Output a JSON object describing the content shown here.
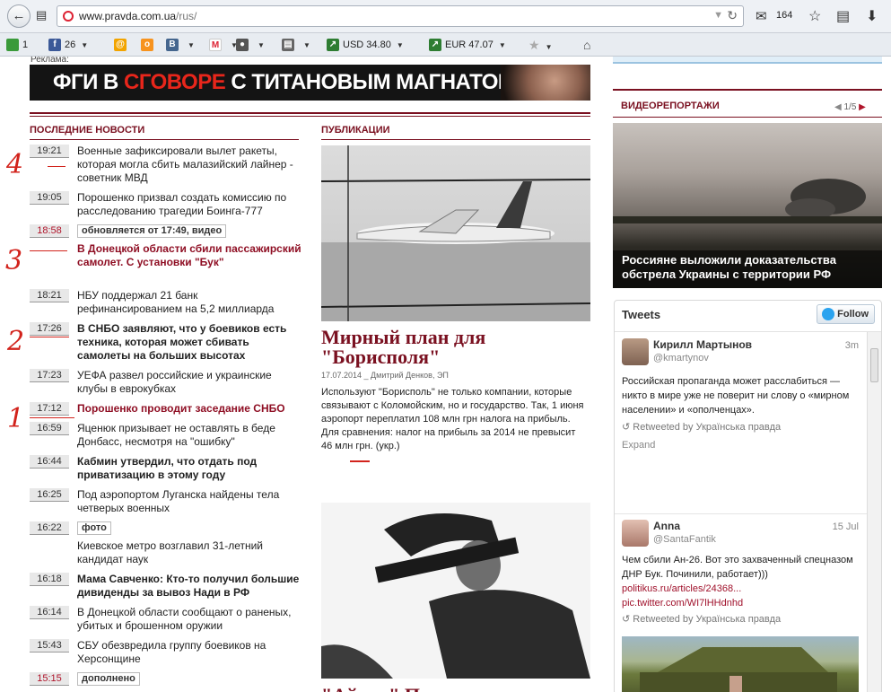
{
  "browser": {
    "url_domain": "www.pravda.com.ua",
    "url_path": "/rus/",
    "mail_count": "164"
  },
  "bookmarks": [
    {
      "label": "1",
      "icon": "home-green-icon"
    },
    {
      "label": "26",
      "icon": "facebook-icon"
    },
    {
      "label": "",
      "icon": "mail-ru-icon"
    },
    {
      "label": "",
      "icon": "odnoklassniki-icon"
    },
    {
      "label": "",
      "icon": "vkontakte-icon"
    },
    {
      "label": "",
      "icon": "gmail-icon"
    },
    {
      "label": "",
      "icon": "camera-icon"
    },
    {
      "label": "",
      "icon": "film-icon"
    },
    {
      "label": "USD 34.80",
      "icon": "chart-icon"
    },
    {
      "label": "EUR 47.07",
      "icon": "chart-icon"
    },
    {
      "label": "",
      "icon": "star-icon"
    },
    {
      "label": "",
      "icon": "home-icon"
    }
  ],
  "ad": {
    "label": "Реклама:",
    "text_white_1": "ФГИ В ",
    "text_red": "СГОВОРЕ",
    "text_white_2": " С ТИТАНОВЫМ МАГНАТОМ"
  },
  "news": {
    "heading": "ПОСЛЕДНИЕ НОВОСТИ",
    "items": [
      {
        "time": "19:21",
        "text": "Военные зафиксировали вылет ракеты, которая могла сбить малазийский лайнер - советник МВД",
        "style": ""
      },
      {
        "time": "19:05",
        "text": "Порошенко призвал создать комиссию по расследованию трагедии Боинга-777",
        "style": ""
      },
      {
        "time": "18:58",
        "tag": "обновляется от 17:49, видео",
        "style": ""
      },
      {
        "time": "",
        "text": "В Донецкой области сбили пассажирский самолет. С установки \"Бук\"",
        "style": "red"
      },
      {
        "time": "18:21",
        "text": "НБУ поддержал 21 банк рефинансированием на 5,2 миллиарда",
        "style": ""
      },
      {
        "time": "17:26",
        "text": "В СНБО заявляют, что у боевиков есть техника, которая может сбивать самолеты на больших высотах",
        "style": "b"
      },
      {
        "time": "17:23",
        "text": "УЕФА развел российские и украинские клубы в еврокубках",
        "style": ""
      },
      {
        "time": "17:12",
        "text": "Порошенко проводит заседание СНБО",
        "style": "red"
      },
      {
        "time": "16:59",
        "text": "Яценюк призывает не оставлять в беде Донбасс, несмотря на \"ошибку\"",
        "style": ""
      },
      {
        "time": "16:44",
        "text": "Кабмин утвердил, что отдать под приватизацию в этому году",
        "style": "b"
      },
      {
        "time": "16:25",
        "text": "Под аэропортом Луганска найдены тела четверых военных",
        "style": ""
      },
      {
        "time": "16:22",
        "tag": "фото",
        "style": ""
      },
      {
        "time": "",
        "text": "Киевское метро возглавил 31-летний кандидат наук",
        "style": ""
      },
      {
        "time": "16:18",
        "text": "Мама Савченко: Кто-то получил большие дивиденды за вывоз Нади в РФ",
        "style": "b"
      },
      {
        "time": "16:14",
        "text": "В Донецкой области сообщают о раненых, убитых и брошенном оружии",
        "style": ""
      },
      {
        "time": "15:43",
        "text": "СБУ обезвредила группу боевиков на Херсонщине",
        "style": ""
      },
      {
        "time": "15:15",
        "tag": "дополнено",
        "style": ""
      }
    ]
  },
  "publications": {
    "heading": "ПУБЛИКАЦИИ",
    "title": "Мирный план для \"Борисполя\"",
    "meta": "17.07.2014 _ Дмитрий Денков, ЭП",
    "text": "Используют \"Борисполь\" не только компании, которые связывают с Коломойским, но и государство. Так, 1 июня аэропорт переплатил 108 млн грн налога на прибыль. Для сравнения: налог на прибыль за 2014 не превысит 46 млн грн. (укр.)",
    "title2": "\"Айдар\" П"
  },
  "video": {
    "heading": "ВИДЕОРЕПОРТАЖИ",
    "pager": "1/5",
    "caption": "Россияне выложили доказательства обстрела Украины с территории РФ"
  },
  "tweets": {
    "title": "Tweets",
    "follow": "Follow",
    "items": [
      {
        "name": "Кирилл Мартынов",
        "handle": "@kmartynov",
        "date": "3m",
        "text": "Российская пропаганда может расслабиться — никто в мире уже не поверит ни слову о «мирном населении» и «ополченцах».",
        "retweet": "Retweeted by Українська правда",
        "expand": "Expand"
      },
      {
        "name": "Anna",
        "handle": "@SantaFantik",
        "date": "15 Jul",
        "text": "Чем сбили Ан-26. Вот это захваченный спецназом ДНР Бук. Починили, работает)))",
        "link1": "politikus.ru/articles/24368...",
        "link2": "pic.twitter.com/WI7lHHdnhd",
        "retweet": "Retweeted by Українська правда"
      }
    ]
  },
  "annotations": [
    "4",
    "3",
    "2",
    "1"
  ]
}
